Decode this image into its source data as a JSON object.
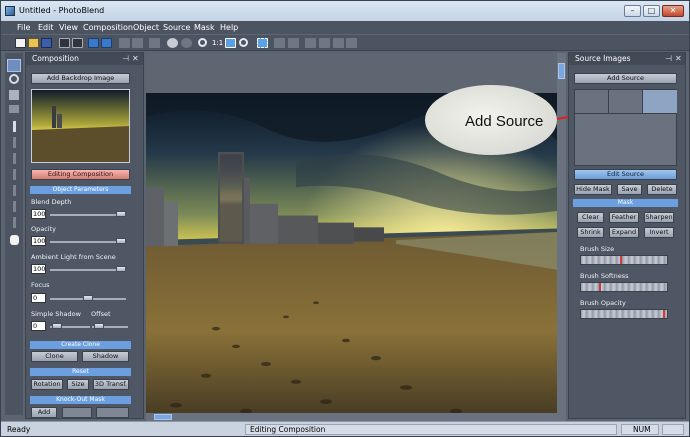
{
  "window": {
    "title": "Untitled - PhotoBlend",
    "controls": [
      "minimize",
      "maximize",
      "close"
    ]
  },
  "menu": [
    "File",
    "Edit",
    "View",
    "Composition",
    "Object",
    "Source",
    "Mask",
    "Help"
  ],
  "toolbar": {
    "zoom_label": "1:1",
    "icons": [
      "new-document-icon",
      "open-folder-icon",
      "save-icon",
      "print-icon",
      "camera-icon",
      "layers-icon",
      "cut-icon",
      "copy-icon",
      "paste-icon",
      "undo-icon",
      "redo-icon",
      "zoom-in-icon",
      "zoom-fit-icon",
      "zoom-out-icon",
      "move-icon"
    ]
  },
  "tools": [
    "arrow-tool-icon",
    "rotate-tool-icon",
    "move-tool-icon",
    "texture-tool-icon",
    "brush-tool-icon",
    "eraser-tool-icon",
    "lasso-tool-icon",
    "pencil-tool-icon",
    "hand-tool-icon"
  ],
  "composition_panel": {
    "title": "Composition",
    "add_backdrop": "Add Backdrop Image",
    "editing_composition": "Editing Composition",
    "object_parameters": "Object Parameters",
    "blend_depth_label": "Blend Depth",
    "blend_depth_value": "100",
    "opacity_label": "Opacity",
    "opacity_value": "100",
    "ambient_label": "Ambient Light from Scene",
    "ambient_value": "100",
    "focus_label": "Focus",
    "focus_value": "0",
    "shadow_label": "Simple Shadow",
    "offset_label": "Offset",
    "shadow_value": "0",
    "create_clone": "Create Clone",
    "clone_btn": "Clone",
    "shadow_btn": "Shadow",
    "reset": "Reset",
    "rotation_btn": "Rotation",
    "size_btn": "Size",
    "transf_btn": "3D Transf.",
    "knockout": "Knock-Out Mask",
    "add_btn": "Add"
  },
  "source_panel": {
    "title": "Source Images",
    "add_source": "Add Source",
    "edit_source": "Edit Source",
    "hide_mask": "Hide Mask",
    "save": "Save",
    "delete": "Delete",
    "mask_section": "Mask",
    "clear": "Clear",
    "feather": "Feather",
    "sharpen": "Sharpen",
    "shrink": "Shrink",
    "expand": "Expand",
    "invert": "Invert",
    "brush_size": "Brush Size",
    "brush_softness": "Brush Softness",
    "brush_opacity": "Brush Opacity"
  },
  "callout": {
    "text": "Add Source",
    "arrow_color": "#e0201c"
  },
  "statusbar": {
    "left": "Ready",
    "center": "Editing Composition",
    "num": "NUM"
  },
  "colors": {
    "accent_blue": "#6b9fdf",
    "editing_red": "#d77d73",
    "panel_bg": "#4f5765"
  }
}
